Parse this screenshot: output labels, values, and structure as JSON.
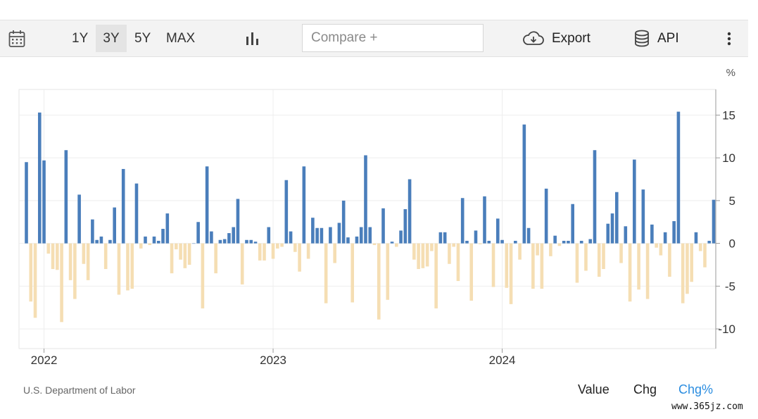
{
  "toolbar": {
    "ranges": [
      "1Y",
      "3Y",
      "5Y",
      "MAX"
    ],
    "active_range": "3Y",
    "compare_placeholder": "Compare +",
    "export_label": "Export",
    "api_label": "API"
  },
  "footer": {
    "source": "U.S. Department of Labor",
    "modes": [
      "Value",
      "Chg",
      "Chg%"
    ],
    "active_mode": "Chg%"
  },
  "watermark": "www.365jz.com",
  "colors": {
    "positive": "#4a7ebb",
    "negative": "#f5deb3",
    "active_mode": "#2b8de0"
  },
  "chart_data": {
    "type": "bar",
    "unit_label": "%",
    "x_tick_labels": [
      "2022",
      "2023",
      "2024"
    ],
    "x_tick_index": [
      4,
      56,
      108
    ],
    "y_ticks": [
      15,
      10,
      5,
      0,
      -5,
      -10
    ],
    "ylim": [
      -12.3,
      18
    ],
    "grid": true,
    "values": [
      9.5,
      -6.8,
      -8.7,
      15.3,
      9.7,
      -1.2,
      -3.0,
      -3.1,
      -9.2,
      10.9,
      -4.3,
      -6.5,
      5.7,
      -2.4,
      -4.3,
      2.8,
      0.4,
      0.8,
      -3.0,
      0.4,
      4.2,
      -6.0,
      8.7,
      -5.5,
      -5.3,
      7.0,
      -0.6,
      0.8,
      -0.2,
      0.8,
      0.3,
      1.7,
      3.5,
      -3.5,
      -0.7,
      -1.9,
      -2.9,
      -2.5,
      0.0,
      2.5,
      -7.6,
      9.0,
      1.4,
      -3.5,
      0.4,
      0.5,
      1.2,
      1.9,
      5.2,
      -4.8,
      0.4,
      0.4,
      0.2,
      -2.0,
      -2.0,
      1.9,
      -1.8,
      -0.6,
      -0.4,
      7.4,
      1.4,
      -1.0,
      -3.3,
      9.0,
      -1.8,
      3.0,
      1.8,
      1.8,
      -7.0,
      1.9,
      -2.3,
      2.4,
      5.0,
      0.7,
      -6.9,
      0.8,
      1.9,
      10.3,
      1.9,
      -0.2,
      -8.9,
      4.1,
      -6.6,
      0.2,
      -0.4,
      1.5,
      4.0,
      7.5,
      -1.9,
      -3.0,
      -2.9,
      -2.7,
      -0.9,
      -7.6,
      1.3,
      1.3,
      -2.4,
      -0.4,
      -4.4,
      5.3,
      0.3,
      -6.7,
      1.5,
      -0.1,
      5.5,
      0.3,
      -5.1,
      2.9,
      0.4,
      -5.2,
      -7.1,
      0.3,
      -1.9,
      13.9,
      1.8,
      -5.3,
      -1.4,
      -5.3,
      6.4,
      -1.5,
      0.9,
      -0.3,
      0.3,
      0.3,
      4.6,
      -4.6,
      0.3,
      -3.2,
      0.5,
      10.9,
      -3.9,
      -3.0,
      2.3,
      3.5,
      6.0,
      -2.3,
      2.0,
      -6.8,
      9.8,
      -5.4,
      6.3,
      -6.5,
      2.2,
      -0.5,
      -1.4,
      1.3,
      -3.9,
      2.6,
      15.4,
      -7.0,
      -5.9,
      -4.5,
      1.3,
      -0.9,
      -2.8,
      0.3,
      5.1
    ]
  }
}
